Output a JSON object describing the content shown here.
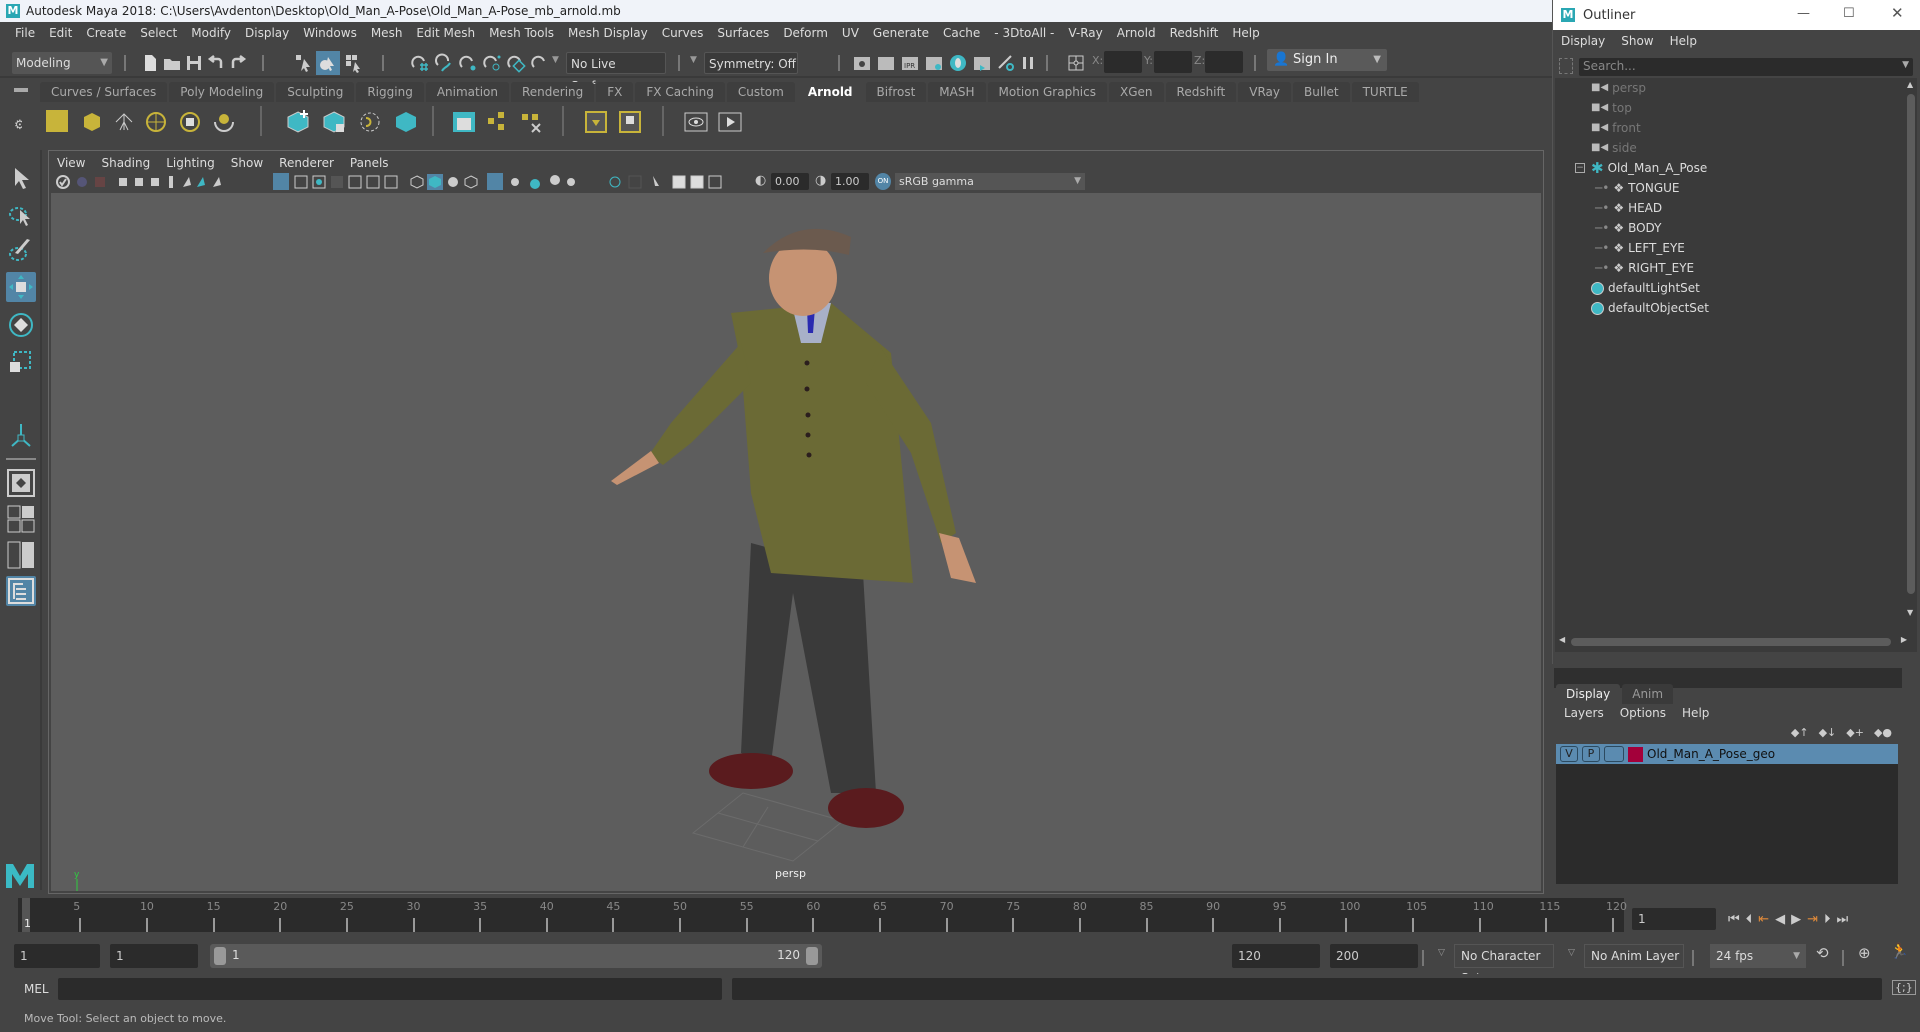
{
  "window": {
    "title": "Autodesk Maya 2018: C:\\Users\\Avdenton\\Desktop\\Old_Man_A-Pose\\Old_Man_A-Pose_mb_arnold.mb"
  },
  "menubar": {
    "items": [
      "File",
      "Edit",
      "Create",
      "Select",
      "Modify",
      "Display",
      "Windows",
      "Mesh",
      "Edit Mesh",
      "Mesh Tools",
      "Mesh Display",
      "Curves",
      "Surfaces",
      "Deform",
      "UV",
      "Generate",
      "Cache",
      "- 3DtoAll -",
      "V-Ray",
      "Arnold",
      "Redshift",
      "Help"
    ]
  },
  "statusline": {
    "mode": "Modeling",
    "live_surface": "No Live Surface",
    "symmetry": "Symmetry: Off",
    "x_label": "X:",
    "y_label": "Y:",
    "z_label": "Z:",
    "x_value": "",
    "y_value": "",
    "z_value": "",
    "sign_in": "Sign In"
  },
  "shelf": {
    "tabs": [
      "Curves / Surfaces",
      "Poly Modeling",
      "Sculpting",
      "Rigging",
      "Animation",
      "Rendering",
      "FX",
      "FX Caching",
      "Custom",
      "Arnold",
      "Bifrost",
      "MASH",
      "Motion Graphics",
      "XGen",
      "Redshift",
      "VRay",
      "Bullet",
      "TURTLE"
    ],
    "active_tab": "Arnold"
  },
  "viewport": {
    "menu": [
      "View",
      "Shading",
      "Lighting",
      "Show",
      "Renderer",
      "Panels"
    ],
    "exposure": "0.00",
    "gamma": "1.00",
    "color_space": "sRGB gamma",
    "camera_label": "persp",
    "colors": {
      "background": "#5d5d5d",
      "jacket": "#6b6a35",
      "pants": "#3d3d3d",
      "shoes": "#5a1b1e",
      "cap": "#6b5a4e",
      "skin": "#c69373"
    }
  },
  "outliner": {
    "title": "Outliner",
    "menu": [
      "Display",
      "Show",
      "Help"
    ],
    "search_placeholder": "Search...",
    "items": [
      {
        "label": "persp",
        "type": "camera",
        "dim": true
      },
      {
        "label": "top",
        "type": "camera",
        "dim": true
      },
      {
        "label": "front",
        "type": "camera",
        "dim": true
      },
      {
        "label": "side",
        "type": "camera",
        "dim": true
      },
      {
        "label": "Old_Man_A_Pose",
        "type": "group",
        "expanded": true
      },
      {
        "label": "TONGUE",
        "type": "mesh",
        "child": true
      },
      {
        "label": "HEAD",
        "type": "mesh",
        "child": true
      },
      {
        "label": "BODY",
        "type": "mesh",
        "child": true
      },
      {
        "label": "LEFT_EYE",
        "type": "mesh",
        "child": true
      },
      {
        "label": "RIGHT_EYE",
        "type": "mesh",
        "child": true
      },
      {
        "label": "defaultLightSet",
        "type": "set"
      },
      {
        "label": "defaultObjectSet",
        "type": "set"
      }
    ]
  },
  "layers": {
    "tabs": [
      "Display",
      "Anim"
    ],
    "active_tab": "Display",
    "menu": [
      "Layers",
      "Options",
      "Help"
    ],
    "rows": [
      {
        "v": "V",
        "p": "P",
        "name": "Old_Man_A_Pose_geo",
        "color": "#a3003a"
      }
    ]
  },
  "timeline": {
    "ticks": [
      5,
      10,
      15,
      20,
      25,
      30,
      35,
      40,
      45,
      50,
      55,
      60,
      65,
      70,
      75,
      80,
      85,
      90,
      95,
      100,
      105,
      110,
      115,
      120
    ],
    "current_frame": "1",
    "range_start": 1,
    "range_end": 120,
    "current_frame_field": "1"
  },
  "range": {
    "start_field": "1",
    "playback_start": "1",
    "slider_start": "1",
    "slider_end": "120",
    "playback_end": "120",
    "end_field": "200",
    "character_set": "No Character Set",
    "anim_layer": "No Anim Layer",
    "fps": "24 fps"
  },
  "commandline": {
    "lang": "MEL",
    "input": "",
    "output": ""
  },
  "helpline": {
    "text": "Move Tool: Select an object to move."
  }
}
